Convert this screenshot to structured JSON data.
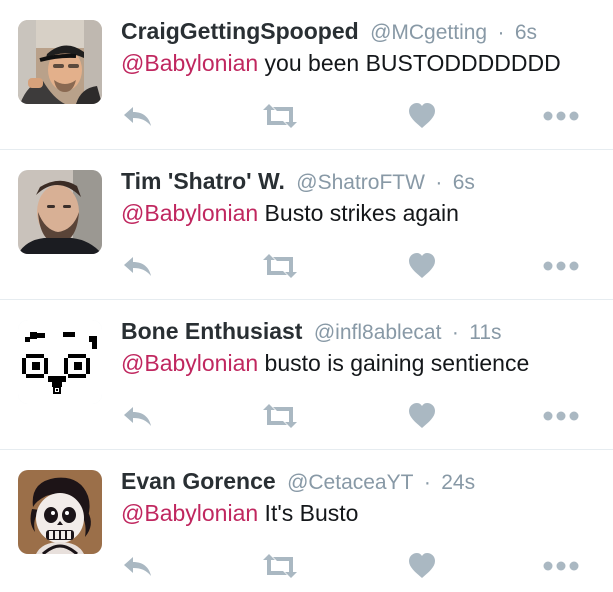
{
  "timeline": {
    "tweets": [
      {
        "name": "CraigGettingSpooped",
        "handle": "@MCgetting",
        "separator": "·",
        "time": "6s",
        "mention": "@Babylonian",
        "text": " you been BUSTODDDDDDD",
        "avatar": "avatar-man-in-cap"
      },
      {
        "name": "Tim 'Shatro' W.",
        "handle": "@ShatroFTW",
        "separator": "·",
        "time": "6s",
        "mention": "@Babylonian",
        "text": " Busto strikes again",
        "avatar": "avatar-bearded-man"
      },
      {
        "name": "Bone Enthusiast",
        "handle": "@infl8ablecat",
        "separator": "·",
        "time": "11s",
        "mention": "@Babylonian",
        "text": " busto is gaining sentience",
        "avatar": "avatar-pixel-face"
      },
      {
        "name": "Evan Gorence",
        "handle": "@CetaceaYT",
        "separator": "·",
        "time": "24s",
        "mention": "@Babylonian",
        "text": " It's Busto",
        "avatar": "avatar-skeleton-cartoon"
      }
    ]
  },
  "icons": {
    "reply": "reply-icon",
    "retweet": "retweet-icon",
    "like": "heart-icon",
    "more": "more-icon"
  },
  "colors": {
    "name": "#292f33",
    "muted": "#8899a6",
    "mention": "#c0275f",
    "icon": "#aab8c2",
    "divider": "#e6ecf0"
  }
}
